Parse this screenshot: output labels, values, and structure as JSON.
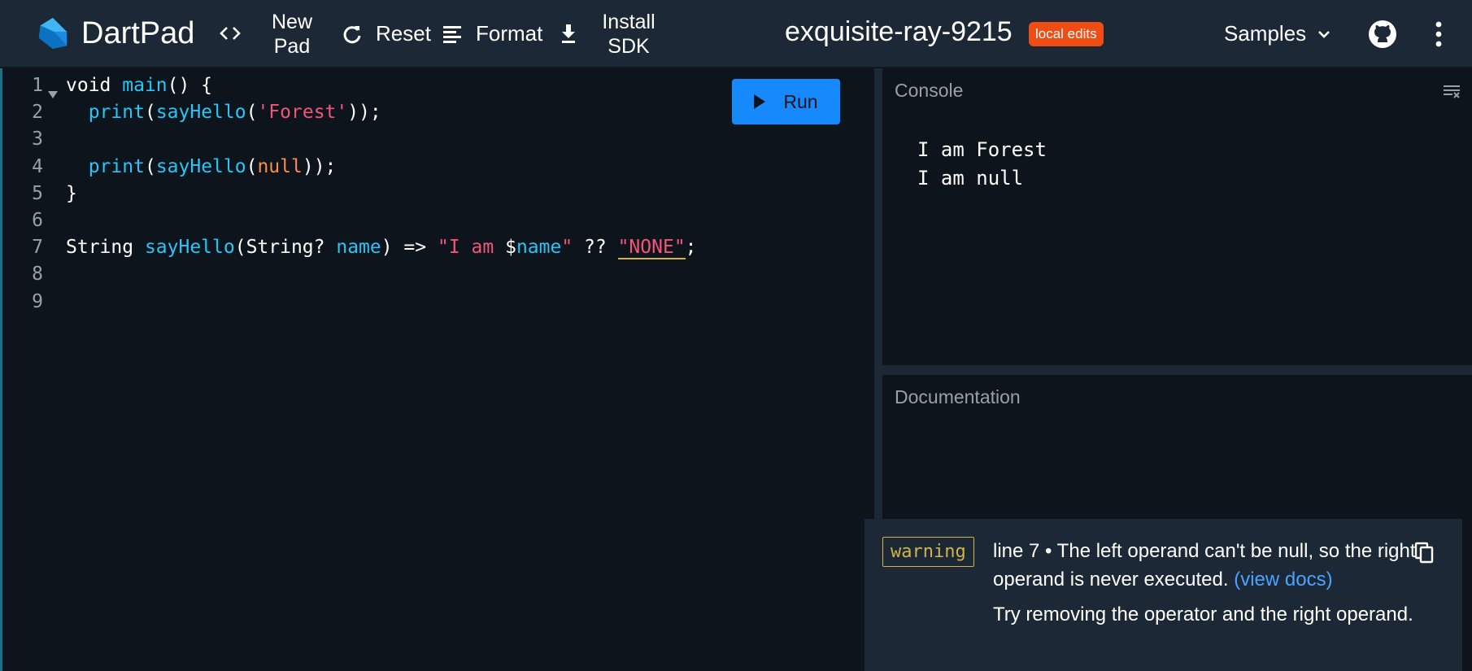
{
  "header": {
    "brand": "DartPad",
    "new_pad_line1": "New",
    "new_pad_line2": "Pad",
    "reset_label": "Reset",
    "format_label": "Format",
    "install_line1": "Install",
    "install_line2": "SDK",
    "pad_name": "exquisite-ray-9215",
    "status_badge": "local edits",
    "samples_label": "Samples",
    "icons": [
      "dart-logo-icon",
      "code-icon",
      "refresh-icon",
      "format-icon",
      "download-icon",
      "chevron-down-icon",
      "github-icon",
      "more-vert-icon"
    ]
  },
  "editor": {
    "line_numbers": [
      "1",
      "2",
      "3",
      "4",
      "5",
      "6",
      "7",
      "8",
      "9"
    ],
    "lines": [
      {
        "tokens": [
          {
            "t": "void ",
            "c": "kw"
          },
          {
            "t": "main",
            "c": "fn"
          },
          {
            "t": "() {",
            "c": "kw"
          }
        ]
      },
      {
        "tokens": [
          {
            "t": "  ",
            "c": "kw"
          },
          {
            "t": "print",
            "c": "fn"
          },
          {
            "t": "(",
            "c": "kw"
          },
          {
            "t": "sayHello",
            "c": "fn"
          },
          {
            "t": "(",
            "c": "kw"
          },
          {
            "t": "'Forest'",
            "c": "str"
          },
          {
            "t": "));",
            "c": "kw"
          }
        ]
      },
      {
        "tokens": []
      },
      {
        "tokens": [
          {
            "t": "  ",
            "c": "kw"
          },
          {
            "t": "print",
            "c": "fn"
          },
          {
            "t": "(",
            "c": "kw"
          },
          {
            "t": "sayHello",
            "c": "fn"
          },
          {
            "t": "(",
            "c": "kw"
          },
          {
            "t": "null",
            "c": "nul"
          },
          {
            "t": "));",
            "c": "kw"
          }
        ]
      },
      {
        "tokens": [
          {
            "t": "}",
            "c": "kw"
          }
        ]
      },
      {
        "tokens": []
      },
      {
        "tokens": [
          {
            "t": "String ",
            "c": "kw"
          },
          {
            "t": "sayHello",
            "c": "fn"
          },
          {
            "t": "(String? ",
            "c": "kw"
          },
          {
            "t": "name",
            "c": "var"
          },
          {
            "t": ") => ",
            "c": "kw"
          },
          {
            "t": "\"I am ",
            "c": "str"
          },
          {
            "t": "$",
            "c": "kw"
          },
          {
            "t": "name",
            "c": "var"
          },
          {
            "t": "\"",
            "c": "str"
          },
          {
            "t": " ?? ",
            "c": "kw"
          },
          {
            "t": "\"NONE\"",
            "c": "str warned"
          },
          {
            "t": ";",
            "c": "kw"
          }
        ]
      },
      {
        "tokens": []
      },
      {
        "tokens": []
      }
    ],
    "run_label": "Run"
  },
  "console": {
    "title": "Console",
    "output": [
      "I am Forest",
      "I am null"
    ]
  },
  "documentation": {
    "title": "Documentation"
  },
  "issue": {
    "severity": "warning",
    "message": "line 7 • The left operand can't be null, so the right operand is never executed.",
    "link_label": "(view docs)",
    "fix": "Try removing the operator and the right operand."
  },
  "colors": {
    "header_bg": "#1c2836",
    "editor_bg": "#0d141c",
    "run_button": "#168afd",
    "badge": "#ef4d14",
    "warning": "#d4b24a",
    "link": "#4aa3ff"
  }
}
